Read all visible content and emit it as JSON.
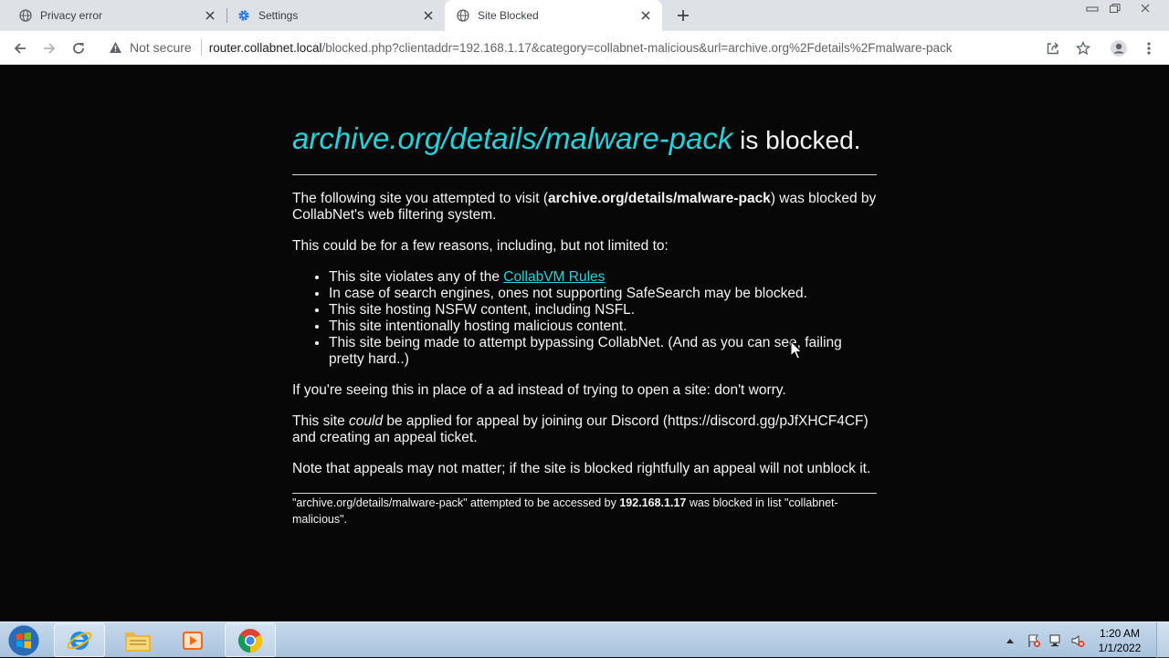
{
  "browser": {
    "tabs": [
      {
        "title": "Privacy error",
        "icon": "globe-icon"
      },
      {
        "title": "Settings",
        "icon": "gear-icon"
      },
      {
        "title": "Site Blocked",
        "icon": "globe-icon",
        "active": true
      }
    ],
    "security_label": "Not secure",
    "url_host": "router.collabnet.local",
    "url_rest": "/blocked.php?clientaddr=192.168.1.17&category=collabnet-malicious&url=archive.org%2Fdetails%2Fmalware-pack"
  },
  "page": {
    "heading_site": "archive.org/details/malware-pack",
    "heading_suffix": " is blocked.",
    "p1_prefix": "The following site you attempted to visit (",
    "p1_site": "archive.org/details/malware-pack",
    "p1_suffix": ") was blocked by CollabNet's web filtering system.",
    "p2": "This could be for a few reasons, including, but not limited to:",
    "reasons": [
      {
        "prefix": "This site violates any of the ",
        "link": "CollabVM Rules"
      },
      {
        "text": "In case of search engines, ones not supporting SafeSearch may be blocked."
      },
      {
        "text": "This site hosting NSFW content, including NSFL."
      },
      {
        "text": "This site intentionally hosting malicious content."
      },
      {
        "text": "This site being made to attempt bypassing CollabNet. (And as you can see, failing pretty hard..)"
      }
    ],
    "p3": "If you're seeing this in place of a ad instead of trying to open a site: don't worry.",
    "p4_prefix": "This site ",
    "p4_em": "could",
    "p4_suffix": " be applied for appeal by joining our Discord (https://discord.gg/pJfXHCF4CF) and creating an appeal ticket.",
    "p5": "Note that appeals may not matter; if the site is blocked rightfully an appeal will not unblock it.",
    "footer_prefix": "\"archive.org/details/malware-pack\" attempted to be accessed by ",
    "footer_ip": "192.168.1.17",
    "footer_suffix": " was blocked in list \"collabnet-malicious\"."
  },
  "colors": {
    "link": "#22d3dc",
    "page_bg": "#070708",
    "text": "#f4f4f4"
  },
  "taskbar": {
    "apps": [
      "internet-explorer-icon",
      "file-explorer-icon",
      "media-player-icon",
      "chrome-icon"
    ],
    "time": "1:20 AM",
    "date": "1/1/2022"
  }
}
